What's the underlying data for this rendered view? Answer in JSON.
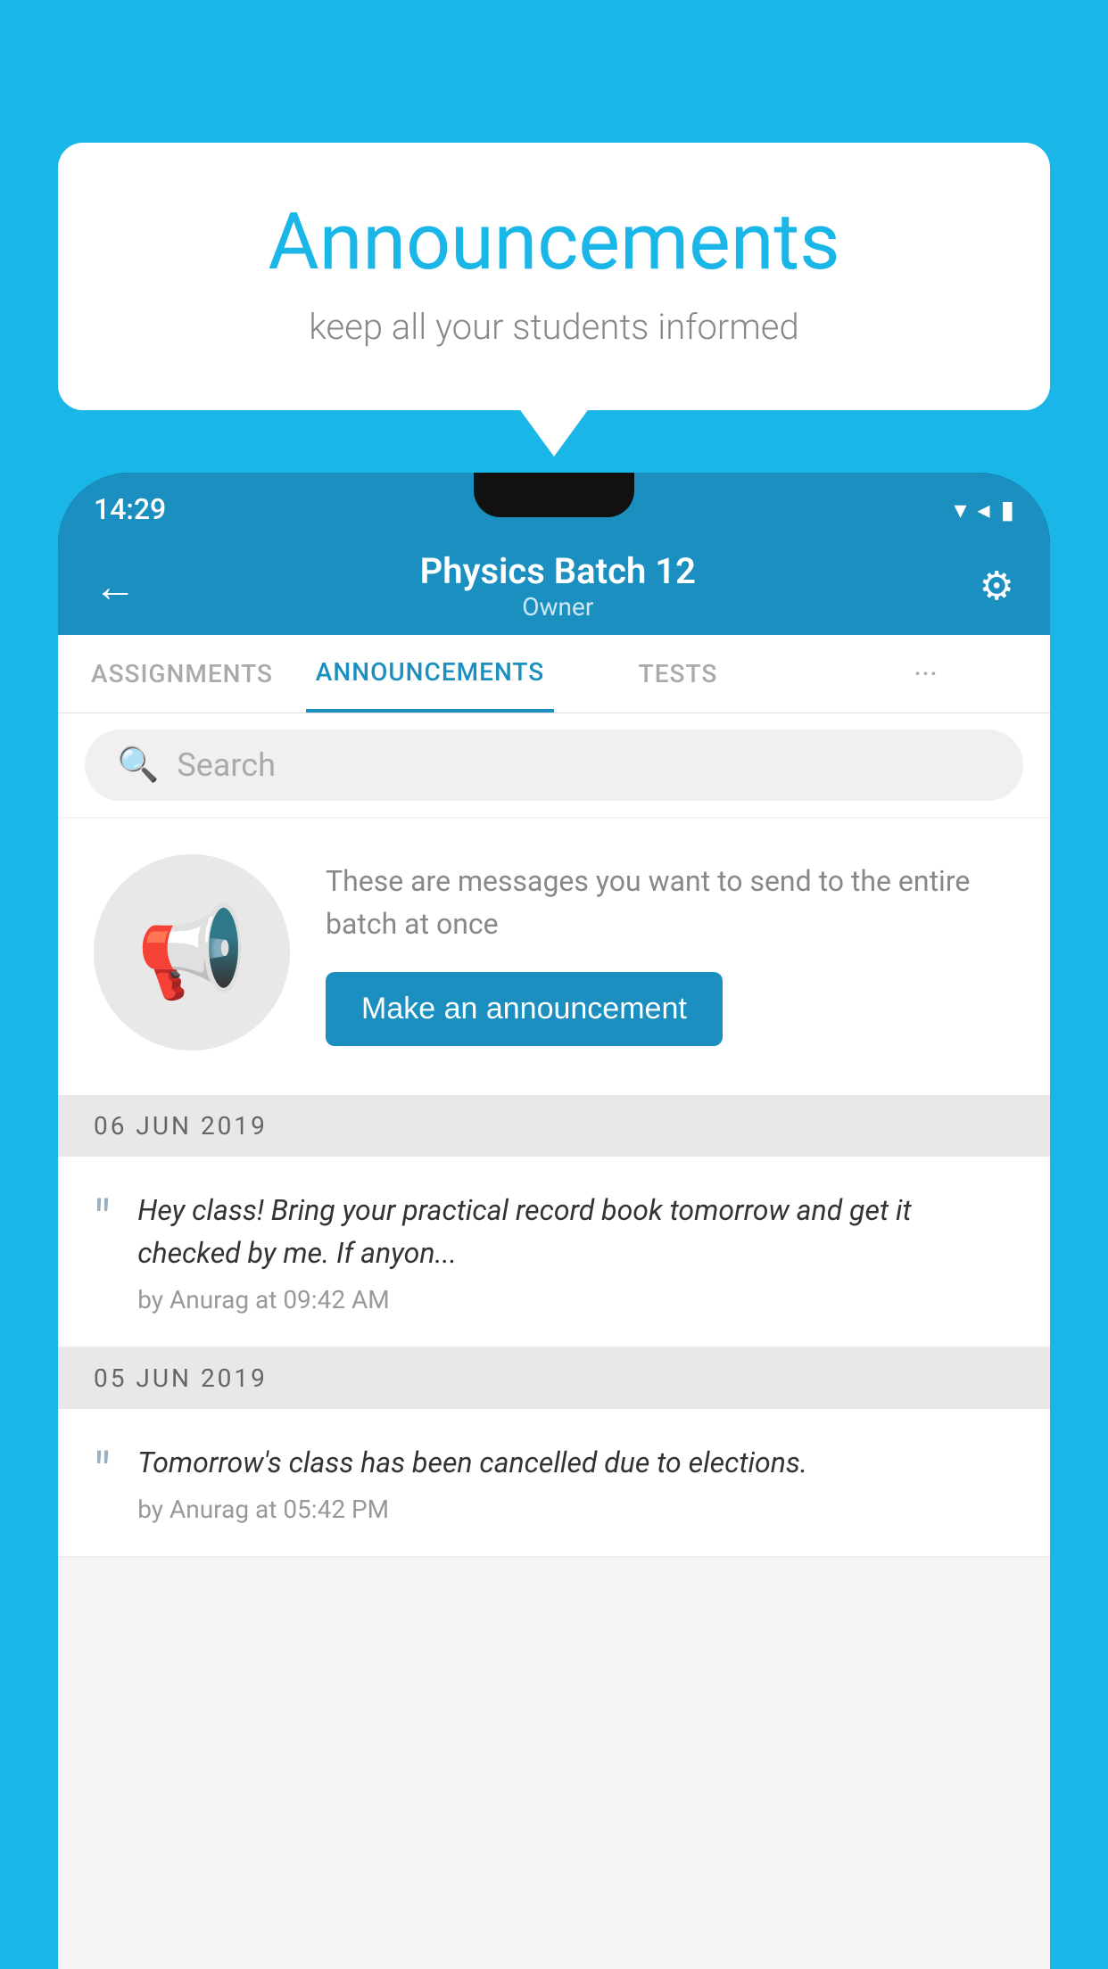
{
  "page": {
    "background_color": "#1ab6e8"
  },
  "speech_bubble": {
    "title": "Announcements",
    "subtitle": "keep all your students informed"
  },
  "phone": {
    "status_bar": {
      "time": "14:29",
      "icons": "▾◂▮"
    },
    "app_bar": {
      "back_label": "←",
      "batch_name": "Physics Batch 12",
      "owner_label": "Owner",
      "gear_label": "⚙"
    },
    "tabs": [
      {
        "label": "ASSIGNMENTS",
        "active": false
      },
      {
        "label": "ANNOUNCEMENTS",
        "active": true
      },
      {
        "label": "TESTS",
        "active": false
      },
      {
        "label": "···",
        "active": false
      }
    ],
    "search": {
      "placeholder": "Search"
    },
    "promo": {
      "description": "These are messages you want to send to the entire batch at once",
      "button_label": "Make an announcement"
    },
    "announcements": [
      {
        "date": "06  JUN  2019",
        "text": "Hey class! Bring your practical record book tomorrow and get it checked by me. If anyon...",
        "meta": "by Anurag at 09:42 AM"
      },
      {
        "date": "05  JUN  2019",
        "text": "Tomorrow's class has been cancelled due to elections.",
        "meta": "by Anurag at 05:42 PM"
      }
    ]
  }
}
